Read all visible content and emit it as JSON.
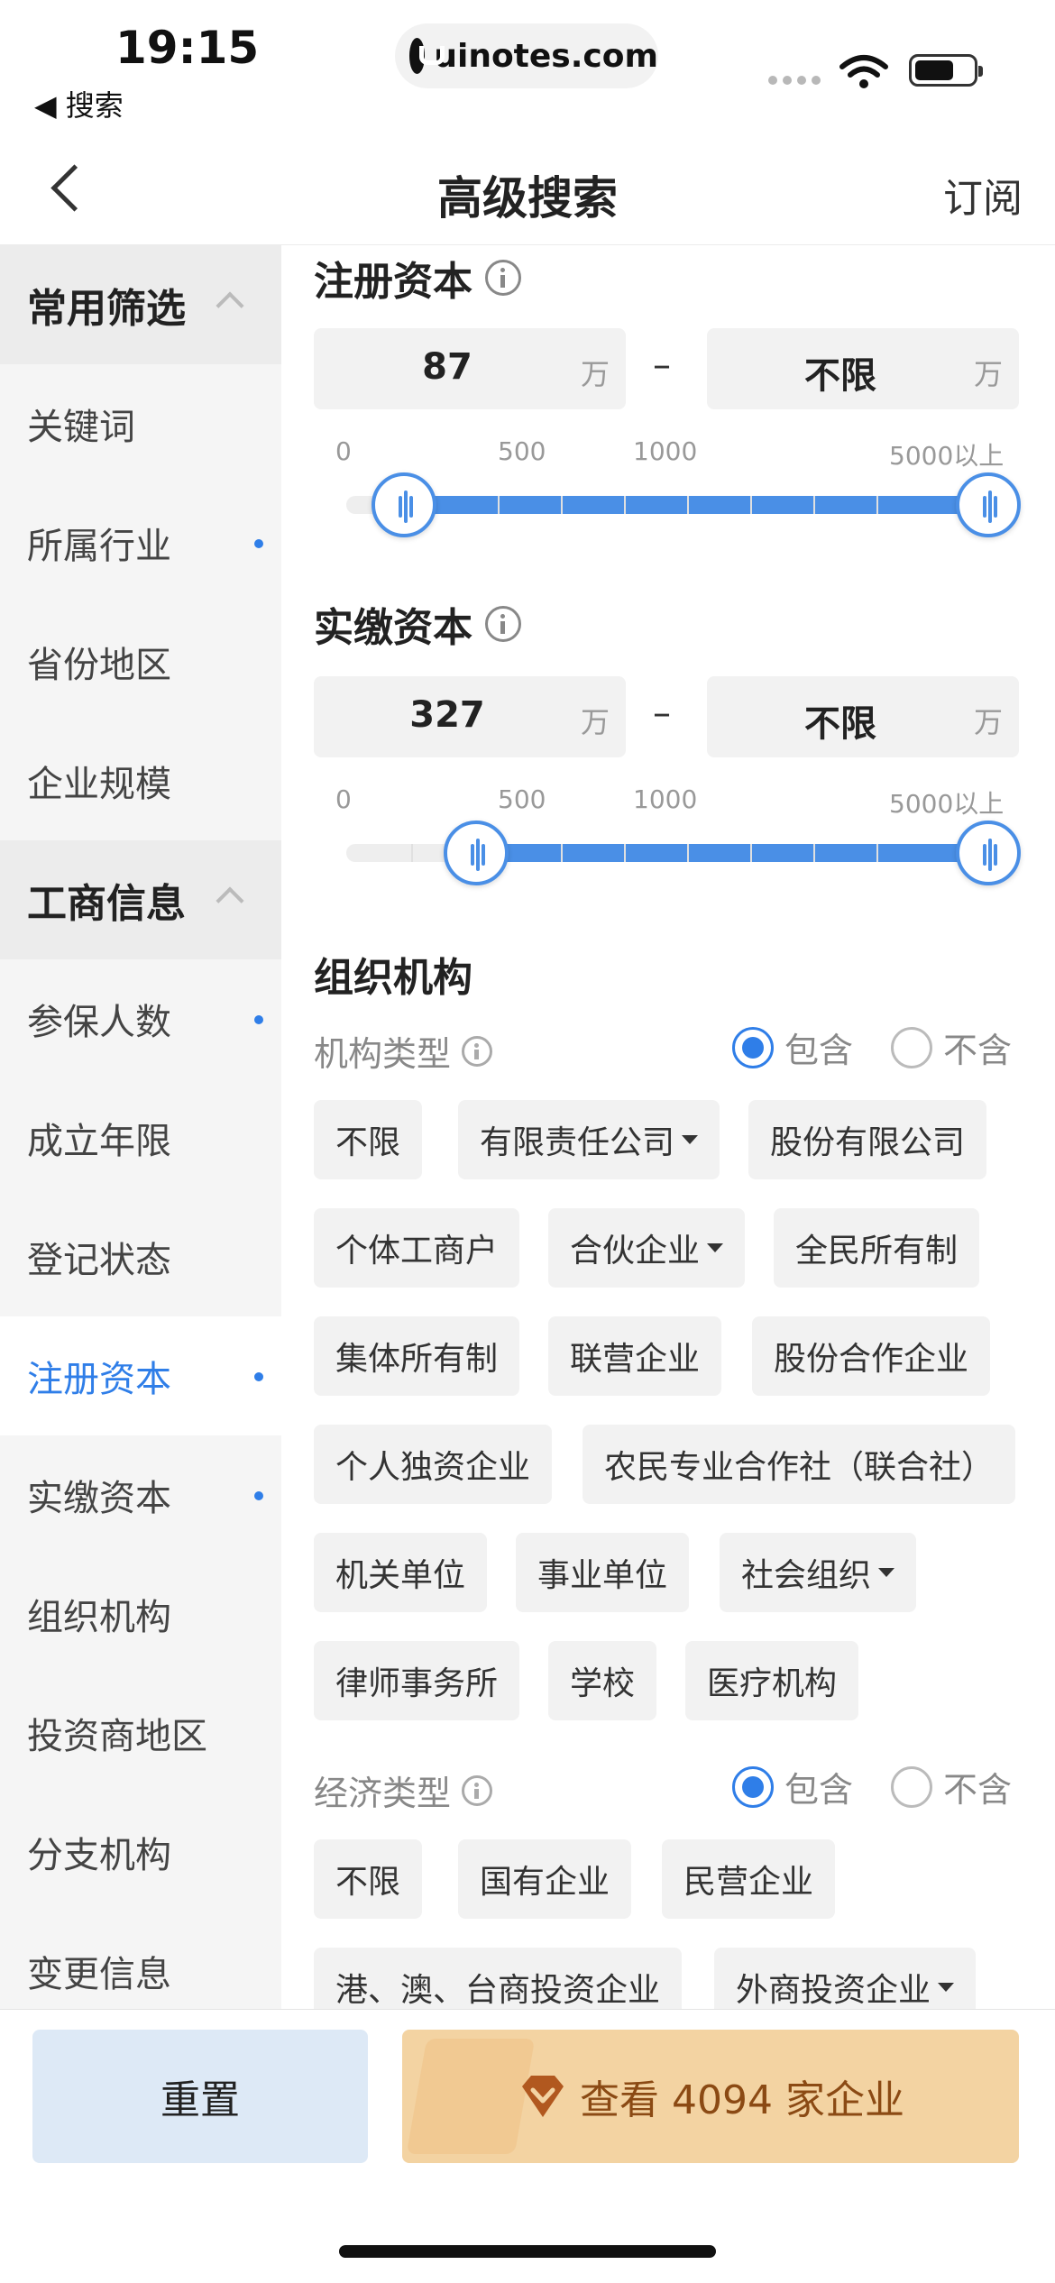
{
  "status_bar": {
    "time": "19:15",
    "back_app": "◀ 搜索",
    "url": "uinotes.com"
  },
  "nav": {
    "title": "高级搜索",
    "right_action": "订阅"
  },
  "sidebar": {
    "items": [
      {
        "label": "常用筛选",
        "type": "group"
      },
      {
        "label": "关键词"
      },
      {
        "label": "所属行业",
        "dot": true
      },
      {
        "label": "省份地区"
      },
      {
        "label": "企业规模"
      },
      {
        "label": "工商信息",
        "type": "group"
      },
      {
        "label": "参保人数",
        "dot": true
      },
      {
        "label": "成立年限"
      },
      {
        "label": "登记状态"
      },
      {
        "label": "注册资本",
        "dot": true,
        "active": true
      },
      {
        "label": "实缴资本",
        "dot": true
      },
      {
        "label": "组织机构"
      },
      {
        "label": "投资商地区"
      },
      {
        "label": "分支机构"
      },
      {
        "label": "变更信息"
      }
    ]
  },
  "registered_capital": {
    "title": "注册资本",
    "min_value": "87",
    "max_value": "不限",
    "unit": "万",
    "dash": "–",
    "ticks": [
      "0",
      "500",
      "1000",
      "5000以上"
    ]
  },
  "paid_capital": {
    "title": "实缴资本",
    "min_value": "327",
    "max_value": "不限",
    "unit": "万",
    "dash": "–",
    "ticks": [
      "0",
      "500",
      "1000",
      "5000以上"
    ]
  },
  "organization": {
    "title": "组织机构",
    "type_label": "机构类型",
    "include": "包含",
    "exclude": "不含",
    "chips": [
      "不限",
      "有限责任公司",
      "股份有限公司",
      "个体工商户",
      "合伙企业",
      "全民所有制",
      "集体所有制",
      "联营企业",
      "股份合作企业",
      "个人独资企业",
      "农民专业合作社（联合社）",
      "机关单位",
      "事业单位",
      "社会组织",
      "律师事务所",
      "学校",
      "医疗机构"
    ]
  },
  "economy": {
    "type_label": "经济类型",
    "include": "包含",
    "exclude": "不含",
    "chips": [
      "不限",
      "国有企业",
      "民营企业",
      "港、澳、台商投资企业",
      "外商投资企业"
    ]
  },
  "footer": {
    "reset": "重置",
    "view": "查看 4094 家企业"
  },
  "colors": {
    "accent": "#2f7ee8",
    "cta_bg": "#f3d3a2",
    "cta_text": "#8b4a14"
  }
}
